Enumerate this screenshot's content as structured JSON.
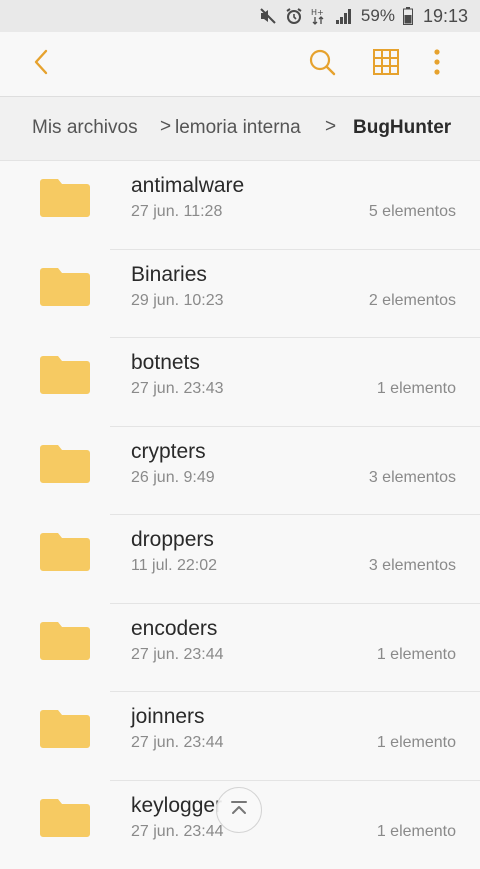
{
  "status_bar": {
    "battery_percent": "59%",
    "time": "19:13",
    "icons": [
      "mute-icon",
      "alarm-icon",
      "data-icon",
      "signal-icon",
      "battery-icon"
    ]
  },
  "toolbar": {
    "back_icon": "chevron-left-icon",
    "search_icon": "search-icon",
    "grid_icon": "grid-view-icon",
    "more_icon": "more-vertical-icon",
    "accent_color": "#e6a22e"
  },
  "breadcrumb": {
    "root": "Mis archivos",
    "middle": "lemoria interna",
    "current": "BugHunter",
    "separator": ">"
  },
  "folders": [
    {
      "name": "antimalware",
      "date": "27 jun. 11:28",
      "count": "5 elementos"
    },
    {
      "name": "Binaries",
      "date": "29 jun. 10:23",
      "count": "2 elementos"
    },
    {
      "name": "botnets",
      "date": "27 jun. 23:43",
      "count": "1 elemento"
    },
    {
      "name": "crypters",
      "date": "26 jun. 9:49",
      "count": "3 elementos"
    },
    {
      "name": "droppers",
      "date": "11 jul. 22:02",
      "count": "3 elementos"
    },
    {
      "name": "encoders",
      "date": "27 jun. 23:44",
      "count": "1 elemento"
    },
    {
      "name": "joinners",
      "date": "27 jun. 23:44",
      "count": "1 elemento"
    },
    {
      "name": "keylogger",
      "date": "27 jun. 23:44",
      "count": "1 elemento"
    }
  ],
  "folder_color": "#f6ca62",
  "scroll_top_icon": "scroll-to-top-icon"
}
